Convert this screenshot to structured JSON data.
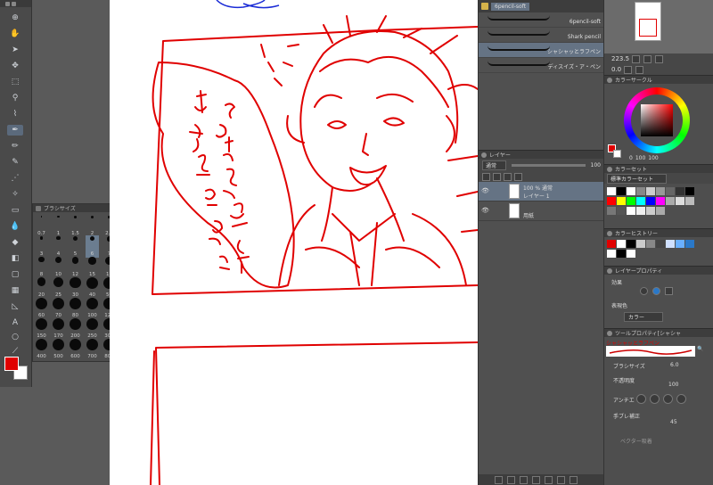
{
  "brush_tool": {
    "tab_label": "6pencil-soft",
    "brushes": [
      {
        "name": "6pencil-soft",
        "selected": false
      },
      {
        "name": "Shark pencil",
        "selected": false
      },
      {
        "name": "シャシャッとラフペン",
        "selected": true
      },
      {
        "name": "ディスイズ・ア・ペン",
        "selected": false
      }
    ]
  },
  "navigator": {
    "zoom": "223.5",
    "rotation": "0.0"
  },
  "color_circle": {
    "title": "カラーサークル",
    "h": "0",
    "s": "100",
    "v": "100"
  },
  "color_set": {
    "title": "カラーセット",
    "preset": "標準カラーセット"
  },
  "layer_panel": {
    "title": "レイヤー",
    "blend_mode": "通常",
    "opacity": "100",
    "layers": [
      {
        "line1": "100 % 通常",
        "line2": "レイヤー 1",
        "selected": true
      },
      {
        "line1": "",
        "line2": "用紙",
        "selected": false
      }
    ]
  },
  "color_history": {
    "title": "カラーヒストリー"
  },
  "layer_property": {
    "title": "レイヤープロパティ",
    "effect_label": "効果",
    "color_label": "表現色",
    "color_value": "カラー"
  },
  "tool_property": {
    "title": "ツールプロパティ[シャシャ",
    "brush_name": "シャシャッとラフペン",
    "brush_size_label": "ブラシサイズ",
    "brush_size_value": "6.0",
    "opacity_label": "不透明度",
    "opacity_value": "100",
    "antialias_label": "アンチエ",
    "stabilization_label": "手ブレ補正",
    "stabilization_value": "45",
    "vector_label": "ベクター吸着"
  },
  "brush_size_palette": {
    "title": "ブラシサイズ",
    "sizes": [
      "0.7",
      "1",
      "1.5",
      "2",
      "2.5",
      "3",
      "4",
      "5",
      "6",
      "7",
      "8",
      "10",
      "12",
      "15",
      "17",
      "20",
      "25",
      "30",
      "40",
      "50",
      "60",
      "70",
      "80",
      "100",
      "120",
      "150",
      "170",
      "200",
      "250",
      "300",
      "400",
      "500",
      "600",
      "700",
      "800"
    ],
    "selected": "6"
  },
  "colors": {
    "main": "#e00000",
    "sub": "#ffffff",
    "selection": "#657384"
  }
}
